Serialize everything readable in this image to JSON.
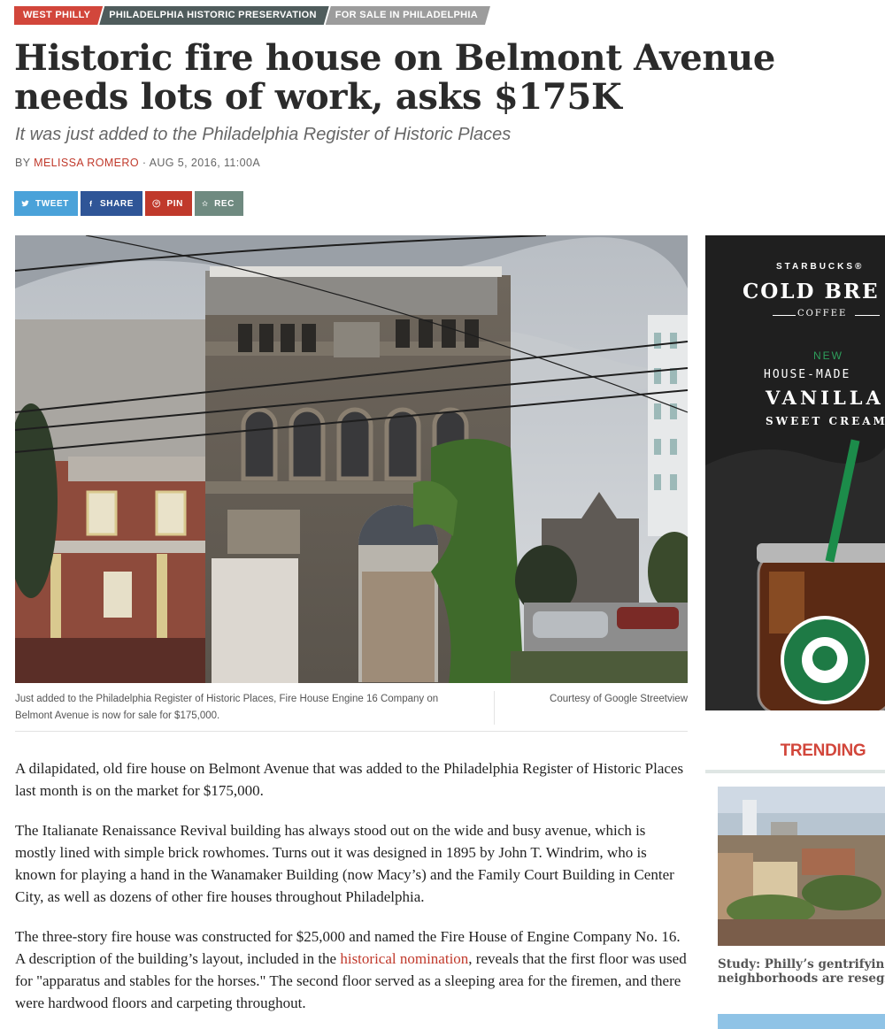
{
  "tags": [
    "WEST PHILLY",
    "PHILADELPHIA HISTORIC PRESERVATION",
    "FOR SALE IN PHILADELPHIA"
  ],
  "headline": "Historic fire house on Belmont Avenue needs lots of work, asks $175K",
  "dek": "It was just added to the Philadelphia Register of Historic Places",
  "byline": {
    "prefix": "BY ",
    "author": "MELISSA ROMERO",
    "separator": " · ",
    "date": "AUG 5, 2016, 11:00A"
  },
  "share": {
    "tweet": "TWEET",
    "share": "SHARE",
    "pin": "PIN",
    "rec": "REC"
  },
  "caption": {
    "text": "Just added to the Philadelphia Register of Historic Places, Fire House Engine 16 Company on Belmont Avenue is now for sale for $175,000.",
    "credit": "Courtesy of Google Streetview"
  },
  "body": {
    "p1": "A dilapidated, old fire house on Belmont Avenue that was added to the Philadelphia Register of Historic Places last month is on the market for $175,000.",
    "p2": "The Italianate Renaissance Revival building has always stood out on the wide and busy avenue, which is mostly lined with simple brick rowhomes. Turns out it was designed in 1895 by John T. Windrim, who is known for playing a hand in the Wanamaker Building (now Macy’s) and the Family Court Building in Center City, as well as dozens of other fire houses throughout Philadelphia.",
    "p3_before": "The three-story fire house was constructed for $25,000 and named the Fire House of Engine Company No. 16. A description of the building’s layout, included in the ",
    "p3_link": "historical nomination",
    "p3_after": ", reveals that the first floor was used for \"apparatus and stables for the horses.\" The second floor served as a sleeping area for the firemen, and there were hardwood floors and carpeting throughout."
  },
  "ad": {
    "brand": "STARBUCKS®",
    "line1": "COLD BRE",
    "line2": "COFFEE",
    "new": "NEW",
    "line3": "HOUSE-MADE",
    "line4": "VANILLA",
    "line5": "SWEET CREAM"
  },
  "trending": {
    "title": "TRENDING",
    "story_title": "Study: Philly’s gentrifying neighborhoods are resegre"
  },
  "colors": {
    "accent_red": "#d2463b",
    "tag_dark": "#4f5c5c",
    "tag_gray": "#9c9c9c",
    "twitter": "#4aa2d9",
    "facebook": "#2f5597",
    "pinterest": "#c0392b",
    "rec": "#6f8a80"
  }
}
